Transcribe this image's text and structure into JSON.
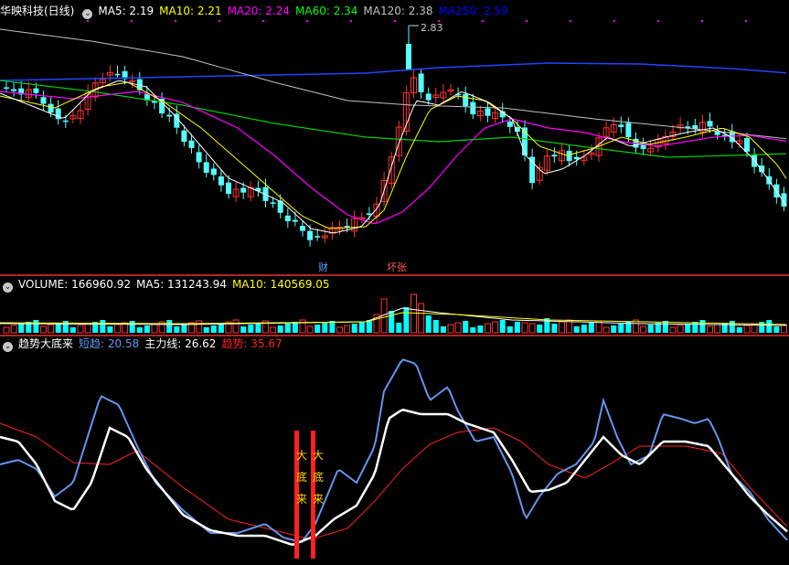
{
  "price_panel": {
    "title": "华映科技(日线)",
    "ma": [
      {
        "label": "MA5: 2.19",
        "color": "#ffffff"
      },
      {
        "label": "MA10: 2.21",
        "color": "#ffff00"
      },
      {
        "label": "MA20: 2.24",
        "color": "#ff00ff"
      },
      {
        "label": "MA60: 2.34",
        "color": "#00ff00"
      },
      {
        "label": "MA120: 2.38",
        "color": "#c0c0c0"
      },
      {
        "label": "MA250: 2.59",
        "color": "#0000ff"
      }
    ],
    "peak_label": "2.83",
    "event_tags": [
      {
        "text": "财",
        "color": "#5aa0ff"
      },
      {
        "text": "坏张",
        "color": "#ff5a5a"
      }
    ],
    "ma250_value": 2.59,
    "ma120_value": 2.38
  },
  "volume_panel": {
    "label": "VOLUME: 166960.92",
    "ma5": "MA5: 131243.94",
    "ma10": "MA10: 140569.05",
    "colors": {
      "up": "#ff3232",
      "down": "#00ffff",
      "ma5": "#ffffff",
      "ma10": "#ffff00"
    }
  },
  "indicator_panel": {
    "name": "趋势大底来",
    "short_trend": "短趋: 20.58",
    "main_line": "主力线: 26.62",
    "trend": "趋势: 35.67",
    "signal_text": [
      "大",
      "底",
      "来"
    ],
    "colors": {
      "short": "#6495ed",
      "main": "#ffffff",
      "trend": "#ff2020",
      "signal_bar": "#ff2020",
      "signal_text": "#ffd700"
    }
  },
  "colors": {
    "bg": "#000000",
    "up": "#ff3232",
    "down": "#54ffff",
    "separator": "#b22222"
  }
}
